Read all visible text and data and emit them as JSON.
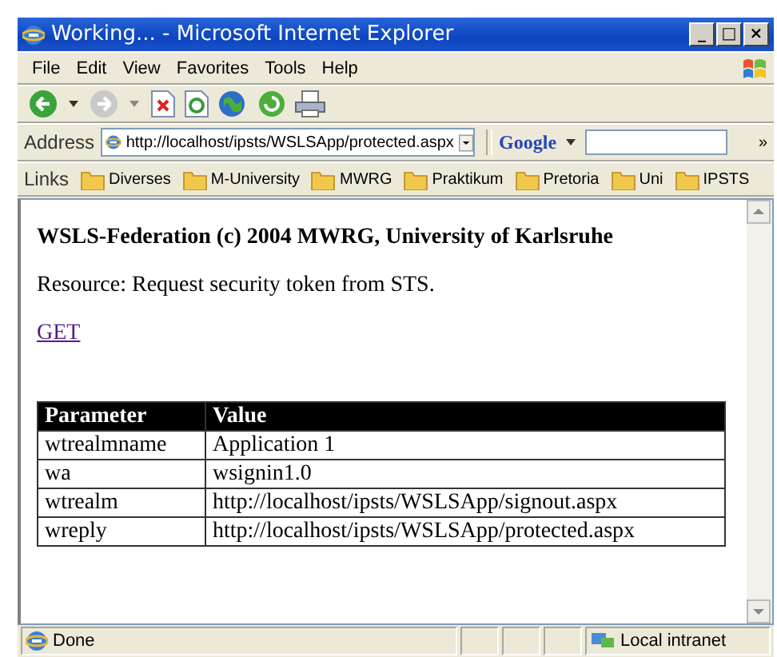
{
  "window": {
    "title": "Working... - Microsoft Internet Explorer",
    "controls": [
      "_",
      "□",
      "×"
    ]
  },
  "menu": [
    "File",
    "Edit",
    "View",
    "Favorites",
    "Tools",
    "Help"
  ],
  "address": {
    "label": "Address",
    "value": "http://localhost/ipsts/WSLSApp/protected.aspx"
  },
  "google": {
    "label": "Google",
    "more": "»"
  },
  "links": {
    "label": "Links",
    "items": [
      "Diverses",
      "M-University",
      "MWRG",
      "Praktikum",
      "Pretoria",
      "Uni",
      "IPSTS"
    ]
  },
  "page": {
    "heading": "WSLS-Federation (c) 2004 MWRG, University of Karlsruhe",
    "text": "Resource: Request security token from STS.",
    "link": "GET",
    "table": {
      "columns": [
        "Parameter",
        "Value"
      ],
      "rows": [
        [
          "wtrealmname",
          "Application 1"
        ],
        [
          "wa",
          "wsignin1.0"
        ],
        [
          "wtrealm",
          "http://localhost/ipsts/WSLSApp/signout.aspx"
        ],
        [
          "wreply",
          "http://localhost/ipsts/WSLSApp/protected.aspx"
        ]
      ]
    }
  },
  "status_bar": {
    "text": "Done",
    "zone": "Local intranet"
  }
}
